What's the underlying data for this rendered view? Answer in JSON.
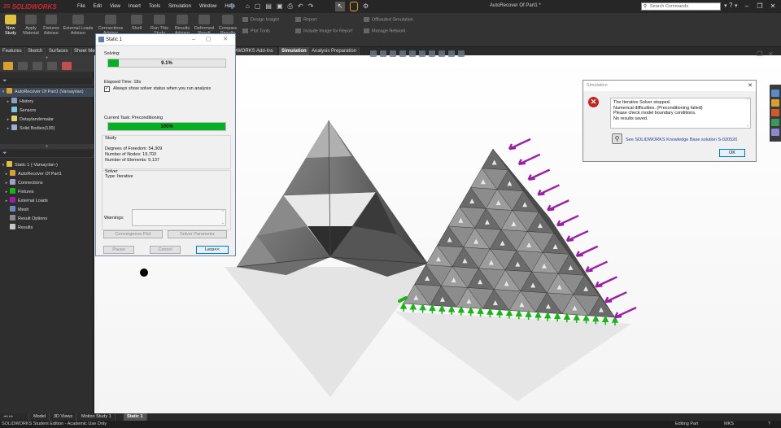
{
  "app": {
    "brand": "SOLIDWORKS",
    "document_title": "AutoRecover Of Part1 *"
  },
  "menu": [
    "File",
    "Edit",
    "View",
    "Insert",
    "Tools",
    "Simulation",
    "Window",
    "Help"
  ],
  "search": {
    "placeholder": "Search Commands"
  },
  "toolbar": {
    "buttons": [
      "New Study",
      "Apply Material",
      "Fixtures Advisor",
      "External Loads Advisor",
      "Connections Advisor",
      "Shell",
      "Run This Study",
      "Results Advisor",
      "Deformed Result",
      "Compare Results"
    ],
    "small": [
      "Design Insight",
      "Plot Tools",
      "Report",
      "Include Image for Report",
      "Offloaded Simulation",
      "Manage Network"
    ]
  },
  "command_tabs": [
    "Features",
    "Sketch",
    "Surfaces",
    "Sheet Metal",
    "SOLIDWORKS Add-Ins",
    "Simulation",
    "Analysis Preparation"
  ],
  "active_command_tab": "Simulation",
  "feature_tree": {
    "root": "AutoRecover Of Part1 (Varsayılan)",
    "items": [
      "History",
      "Sensors",
      "Detaylandırmalar",
      "Solid Bodies(130)"
    ]
  },
  "sim_tree": {
    "root": "Static 1 (-Varsayılan-)",
    "items": [
      "AutoRecover Of Part1",
      "Connections",
      "Fixtures",
      "External Loads",
      "Mesh",
      "Result Options",
      "Results"
    ]
  },
  "static_dialog": {
    "title": "Static 1",
    "solving_label": "Solving:",
    "solving_percent_text": "9.1%",
    "solving_fraction": 0.091,
    "elapsed": "Elapsed Time: 18s",
    "always_show": "Always show solver status when you run analysis",
    "always_show_checked": true,
    "current_task": "Current Task: Preconditioning",
    "task_percent_text": "100%",
    "task_fraction": 1.0,
    "study_heading": "Study",
    "study_lines": [
      "Degrees of Freedom: 54,309",
      "Number of Nodes: 19,703",
      "Number of Elements: 9,137"
    ],
    "solver_heading": "Solver",
    "solver_type": "Type: Iterative",
    "warnings_label": "Warnings:",
    "convergence_plot": "Convergence Plot",
    "solver_parameter": "Solver Parameter",
    "pause": "Pause",
    "cancel": "Cancel",
    "less": "Less<<"
  },
  "error_dialog": {
    "title": "Simulation",
    "messages": [
      "The Iterative Solver stopped.",
      "Numerical difficulties. (Preconditioning failed)",
      "Please check model boundary conditions.",
      "No results saved."
    ],
    "kb_link": "See SOLIDWORKS Knowledge Base solution S-020520",
    "ok": "OK"
  },
  "bottom_tabs": [
    "Model",
    "3D Views",
    "Motion Study 1",
    "Static 1"
  ],
  "active_bottom_tab": "Static 1",
  "status": {
    "left": "SOLIDWORKS Student Edition - Academic Use Only",
    "mode": "Editing Part",
    "units": "MKS"
  },
  "colors": {
    "fixture": "#19b416",
    "load": "#9b1fa6",
    "progress": "#06b025",
    "error": "#c8211f"
  }
}
